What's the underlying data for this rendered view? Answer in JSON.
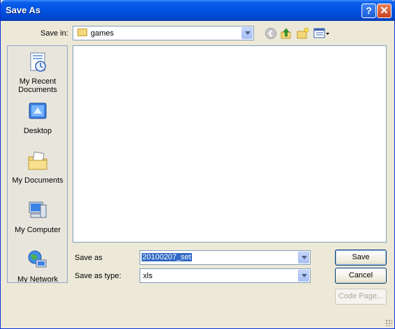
{
  "dialog": {
    "title": "Save As",
    "help_glyph": "?",
    "close_glyph": "✕"
  },
  "toolbar": {
    "save_in_label": "Save in:",
    "save_in_value": "games"
  },
  "places": [
    {
      "label_line1": "My Recent",
      "label_line2": "Documents",
      "icon": "recent-documents-icon"
    },
    {
      "label_line1": "Desktop",
      "label_line2": "",
      "icon": "desktop-icon"
    },
    {
      "label_line1": "My Documents",
      "label_line2": "",
      "icon": "my-documents-icon"
    },
    {
      "label_line1": "My Computer",
      "label_line2": "",
      "icon": "my-computer-icon"
    },
    {
      "label_line1": "My Network",
      "label_line2": "",
      "icon": "my-network-icon"
    }
  ],
  "form": {
    "save_as_label": "Save as",
    "save_as_value": "20100207_set",
    "type_label": "Save as type:",
    "type_value": "xls"
  },
  "buttons": {
    "save": "Save",
    "cancel": "Cancel",
    "code_page": "Code Page..."
  },
  "colors": {
    "title_bar": "#0054e3",
    "dialog_bg": "#ece9d8",
    "selection": "#316ac5"
  }
}
